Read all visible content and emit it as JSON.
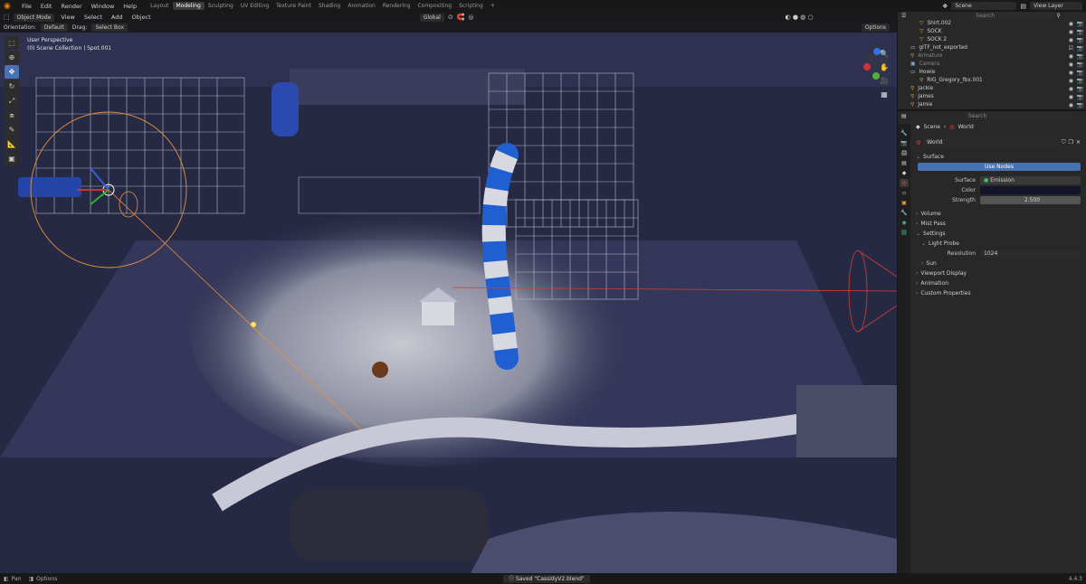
{
  "menu": [
    "File",
    "Edit",
    "Render",
    "Window",
    "Help"
  ],
  "workspaces": [
    "Layout",
    "Modeling",
    "Sculpting",
    "UV Editing",
    "Texture Paint",
    "Shading",
    "Animation",
    "Rendering",
    "Compositing",
    "Scripting",
    "+"
  ],
  "active_workspace": "Modeling",
  "scene_name": "Scene",
  "view_layer": "View Layer",
  "viewport": {
    "mode": "Object Mode",
    "header_menus": [
      "View",
      "Select",
      "Add",
      "Object"
    ],
    "transform_orientation": "Global",
    "orientation_label": "Orientation:",
    "orientation_value": "Default",
    "drag_label": "Drag:",
    "drag_value": "Select Box",
    "options_label": "Options",
    "perspective": "User Perspective",
    "collection": "(0) Scene Collection | Spot.001"
  },
  "outliner": {
    "search_placeholder": "Search",
    "rows": [
      {
        "name": "Shirt.002",
        "extra": ""
      },
      {
        "name": "SOCK",
        "extra": ""
      },
      {
        "name": "SOCK 2",
        "extra": ""
      },
      {
        "name": "glTF_not_exported",
        "extra": ""
      },
      {
        "name": "Armature",
        "extra": ""
      },
      {
        "name": "Camera",
        "extra": ""
      },
      {
        "name": "Howie",
        "extra": ""
      },
      {
        "name": "RIG_Gregory_fbx.001",
        "extra": ""
      },
      {
        "name": "Jackie",
        "extra": ""
      },
      {
        "name": "James",
        "extra": ""
      },
      {
        "name": "Jamie",
        "extra": ""
      }
    ]
  },
  "properties": {
    "search_placeholder": "Search",
    "breadcrumb_scene": "Scene",
    "breadcrumb_world": "World",
    "world_name": "World",
    "surface_section": "Surface",
    "use_nodes": "Use Nodes",
    "surface_label": "Surface",
    "surface_value": "Emission",
    "color_label": "Color",
    "color_value": "#1a1a2e",
    "strength_label": "Strength",
    "strength_value": "2.500",
    "volume": "Volume",
    "mist_pass": "Mist Pass",
    "settings": "Settings",
    "light_probe": "Light Probe",
    "resolution_label": "Resolution",
    "resolution_value": "1024",
    "sun": "Sun",
    "viewport_display": "Viewport Display",
    "animation": "Animation",
    "custom_properties": "Custom Properties"
  },
  "status": {
    "pan": "Pan",
    "options": "Options",
    "saved": "Saved \"CassidyV2.blend\"",
    "version": "4.4.3"
  },
  "colors": {
    "accent": "#4772b3",
    "scene_dark": "#2a2d4a",
    "spot_light": "#e8903a"
  }
}
